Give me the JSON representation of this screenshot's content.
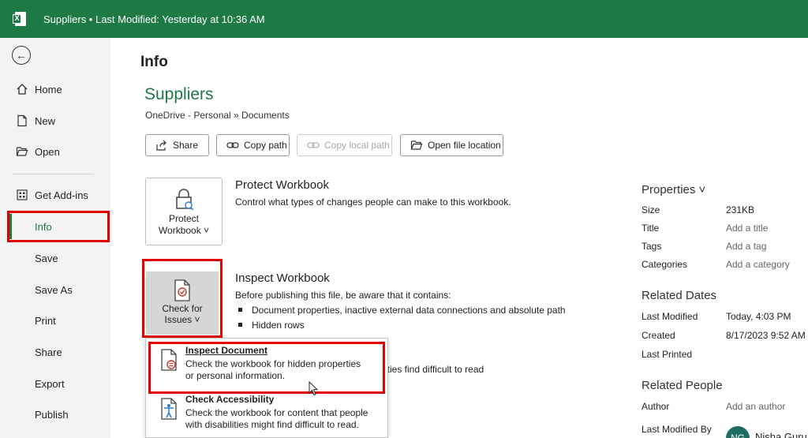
{
  "titlebar": {
    "title": "Suppliers  •  Last Modified: Yesterday at 10:36 AM"
  },
  "sidebar": {
    "items": [
      {
        "label": "Home",
        "icon": "home-icon"
      },
      {
        "label": "New",
        "icon": "new-document-icon"
      },
      {
        "label": "Open",
        "icon": "folder-open-icon"
      },
      {
        "label": "Get Add-ins",
        "icon": "add-ins-grid-icon"
      },
      {
        "label": "Info"
      },
      {
        "label": "Save"
      },
      {
        "label": "Save As"
      },
      {
        "label": "Print"
      },
      {
        "label": "Share"
      },
      {
        "label": "Export"
      },
      {
        "label": "Publish"
      }
    ]
  },
  "main": {
    "page_title": "Info",
    "doc_name": "Suppliers",
    "doc_path": "OneDrive - Personal » Documents",
    "buttons": {
      "share": "Share",
      "copy_path": "Copy path",
      "copy_local_path": "Copy local path",
      "open_file_location": "Open file location"
    },
    "protect": {
      "tile_line1": "Protect",
      "tile_line2": "Workbook ˅",
      "title": "Protect Workbook",
      "desc": "Control what types of changes people can make to this workbook."
    },
    "inspect": {
      "tile_line1": "Check for",
      "tile_line2": "Issues ˅",
      "title": "Inspect Workbook",
      "desc": "Before publishing this file, be aware that it contains:",
      "bullets": [
        "Document properties, inactive external data connections and absolute path",
        "Hidden rows"
      ],
      "partial_text": "ities find difficult to read"
    },
    "dropdown": {
      "inspect_title": "Inspect Document",
      "inspect_desc_1": "Check the workbook for hidden properties",
      "inspect_desc_2": "or personal information.",
      "access_title": "Check Accessibility",
      "access_desc_1": "Check the workbook for content that people",
      "access_desc_2": "with disabilities might find difficult to read."
    }
  },
  "properties": {
    "title": "Properties ˅",
    "rows": [
      {
        "k": "Size",
        "v": "231KB"
      },
      {
        "k": "Title",
        "v": "Add a title"
      },
      {
        "k": "Tags",
        "v": "Add a tag"
      },
      {
        "k": "Categories",
        "v": "Add a category"
      }
    ],
    "related_dates_title": "Related Dates",
    "dates": [
      {
        "k": "Last Modified",
        "v": "Today, 4:03 PM"
      },
      {
        "k": "Created",
        "v": "8/17/2023 9:52 AM"
      },
      {
        "k": "Last Printed",
        "v": ""
      }
    ],
    "related_people_title": "Related People",
    "author_label": "Author",
    "author_value": "Add an author",
    "last_modified_by_label": "Last Modified By",
    "avatar_initials": "NG",
    "last_modified_by_name": "Nisha Guru"
  },
  "colors": {
    "brand": "#1d7a45",
    "highlight": "#e00000"
  }
}
